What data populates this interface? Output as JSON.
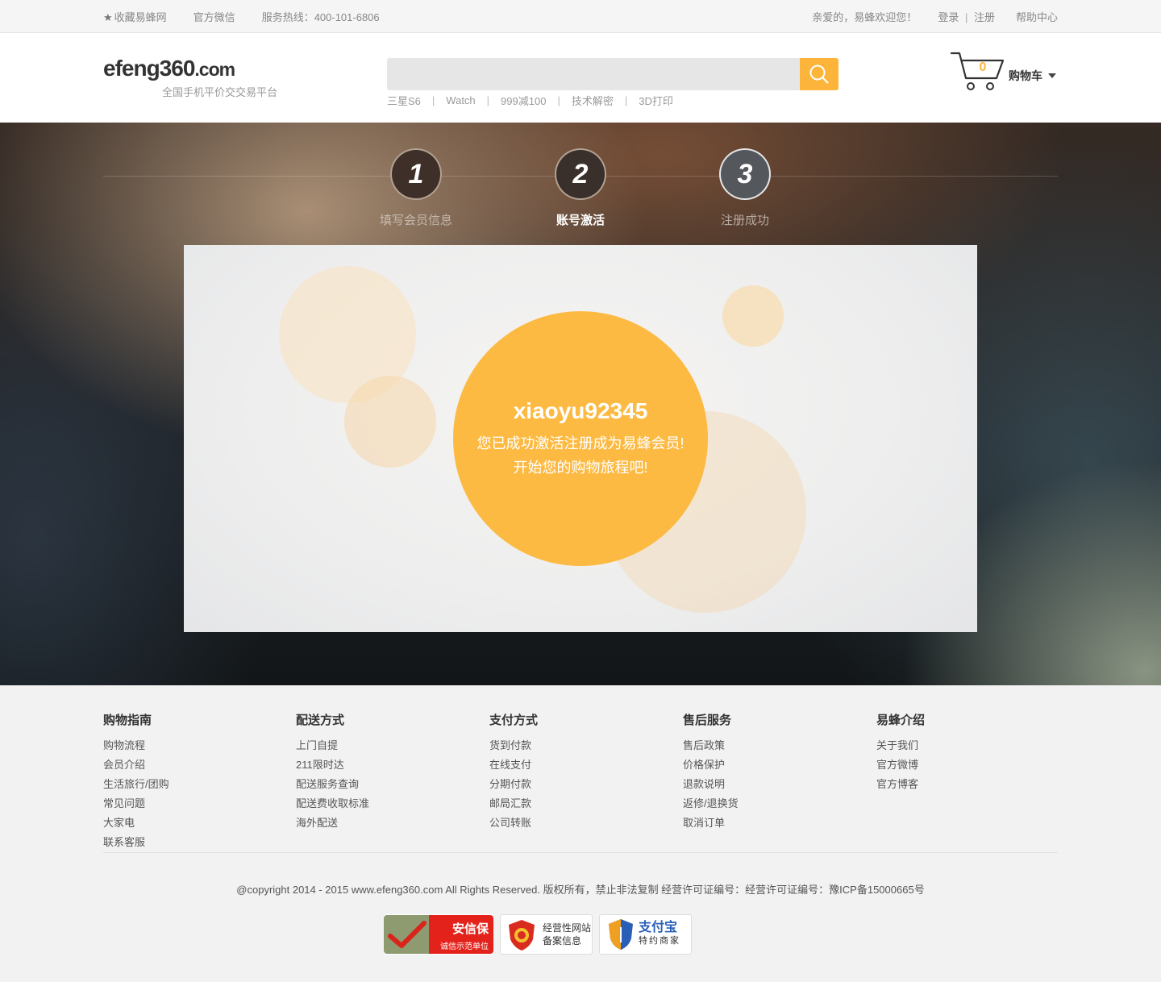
{
  "topbar": {
    "favorite": "收藏易蜂网",
    "wechat": "官方微信",
    "hotline": "服务热线：400-101-6806",
    "welcome": "亲爱的，易蜂欢迎您！",
    "login": "登录",
    "divider": "|",
    "register": "注册",
    "help": "帮助中心"
  },
  "header": {
    "logo_main": "efeng360",
    "logo_suffix": ".com",
    "logo_sub": "全国手机平价交交易平台",
    "search_placeholder": "",
    "hotwords": [
      "三星S6",
      "Watch",
      "999减100",
      "技术解密",
      "3D打印"
    ],
    "hotword_sep": "|",
    "cart_count": "0",
    "cart_label": "购物车"
  },
  "steps": [
    {
      "num": "1",
      "label": "填写会员信息"
    },
    {
      "num": "2",
      "label": "账号激活"
    },
    {
      "num": "3",
      "label": "注册成功"
    }
  ],
  "success": {
    "username": "xiaoyu92345",
    "line1": "您已成功激活注册成为易蜂会员!",
    "line2": "开始您的购物旅程吧!"
  },
  "footer": {
    "columns": [
      {
        "title": "购物指南",
        "links": [
          "购物流程",
          "会员介绍",
          "生活旅行/团购",
          "常见问题",
          "大家电",
          "联系客服"
        ]
      },
      {
        "title": "配送方式",
        "links": [
          "上门自提",
          "211限时达",
          "配送服务查询",
          "配送费收取标准",
          "海外配送"
        ]
      },
      {
        "title": "支付方式",
        "links": [
          "货到付款",
          "在线支付",
          "分期付款",
          "邮局汇款",
          "公司转账"
        ]
      },
      {
        "title": "售后服务",
        "links": [
          "售后政策",
          "价格保护",
          "退款说明",
          "返修/退换货",
          "取消订单"
        ]
      },
      {
        "title": "易蜂介绍",
        "links": [
          "关于我们",
          "官方微博",
          "官方博客"
        ]
      }
    ],
    "copyright": "@copyright 2014 - 2015 www.efeng360.com All Rights Reserved. 版权所有，禁止非法复制 经营许可证编号：经营许可证编号：豫ICP备15000665号",
    "badges": {
      "anxinbao_title": "安信保",
      "anxinbao_sub": "诚信示范单位",
      "record_line1": "经营性网站",
      "record_line2": "备案信息",
      "alipay_title": "支付宝",
      "alipay_sub": "特约商家"
    }
  },
  "colors": {
    "accent": "#fcb53a",
    "success_circle": "#fdba42"
  }
}
